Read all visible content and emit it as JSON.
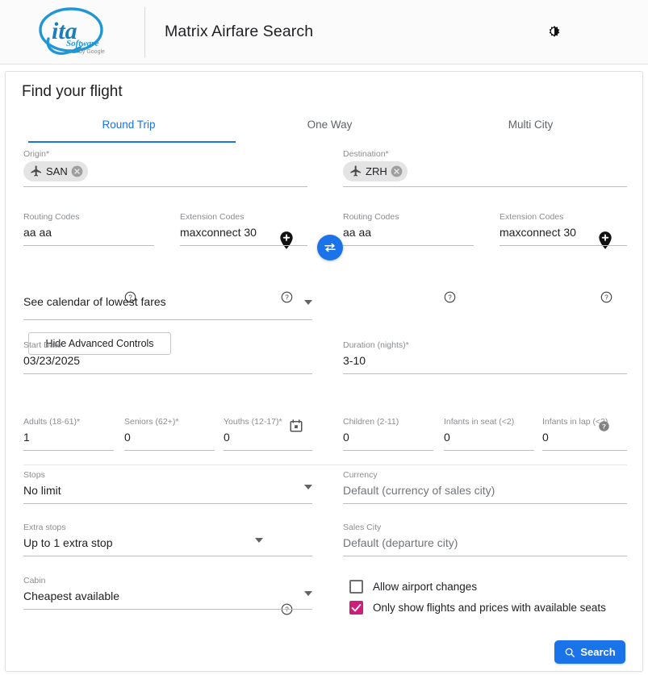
{
  "header": {
    "app_title": "Matrix Airfare Search",
    "logo_main": "ita",
    "logo_sub": "Software",
    "logo_byline": "by Google",
    "theme_toggle_name": "brightness-icon"
  },
  "card": {
    "title": "Find your flight"
  },
  "tabs": [
    {
      "label": "Round Trip",
      "active": true
    },
    {
      "label": "One Way",
      "active": false
    },
    {
      "label": "Multi City",
      "active": false
    }
  ],
  "origin": {
    "label": "Origin*",
    "chip_code": "SAN"
  },
  "destination": {
    "label": "Destination*",
    "chip_code": "ZRH"
  },
  "routing_origin": {
    "label": "Routing Codes",
    "value": "aa aa"
  },
  "extension_origin": {
    "label": "Extension Codes",
    "value": "maxconnect 30"
  },
  "routing_destination": {
    "label": "Routing Codes",
    "value": "aa aa"
  },
  "extension_destination": {
    "label": "Extension Codes",
    "value": "maxconnect 30"
  },
  "advanced_controls": {
    "button_label": "Hide Advanced Controls"
  },
  "calendar_select": {
    "value": "See calendar of lowest fares"
  },
  "start_date": {
    "label": "Start Date",
    "value": "03/23/2025"
  },
  "duration": {
    "label": "Duration (nights)*",
    "value": "3-10"
  },
  "passengers": [
    {
      "label": "Adults (18-61)*",
      "value": "1"
    },
    {
      "label": "Seniors (62+)*",
      "value": "0"
    },
    {
      "label": "Youths (12-17)*",
      "value": "0"
    },
    {
      "label": "Children (2-11)",
      "value": "0"
    },
    {
      "label": "Infants in seat (<2)",
      "value": "0"
    },
    {
      "label": "Infants in lap (<2)",
      "value": "0"
    }
  ],
  "stops": {
    "label": "Stops",
    "value": "No limit"
  },
  "currency": {
    "label": "Currency",
    "value": "Default (currency of sales city)"
  },
  "extra_stops": {
    "label": "Extra stops",
    "value": "Up to 1 extra stop"
  },
  "sales_city": {
    "label": "Sales City",
    "value": "Default (departure city)"
  },
  "cabin": {
    "label": "Cabin",
    "value": "Cheapest available"
  },
  "checkboxes": [
    {
      "label": "Allow airport changes",
      "checked": false
    },
    {
      "label": "Only show flights and prices with available seats",
      "checked": true
    }
  ],
  "search_button": {
    "label": "Search"
  },
  "colors": {
    "accent_blue": "#1a73e8",
    "checkbox_magenta": "#cc1f7c",
    "label_gray": "#8a8d91",
    "text_dark": "#202124"
  }
}
